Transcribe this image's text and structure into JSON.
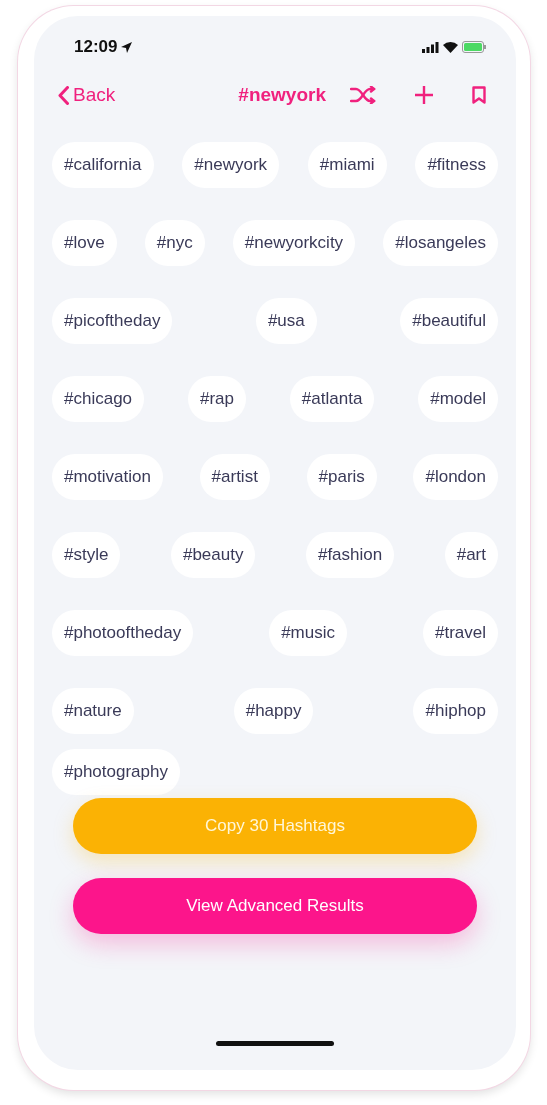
{
  "status_bar": {
    "time": "12:09"
  },
  "nav": {
    "back": "Back",
    "title": "#newyork"
  },
  "tag_rows": [
    [
      "#california",
      "#newyork",
      "#miami",
      "#fitness"
    ],
    [
      "#love",
      "#nyc",
      "#newyorkcity",
      "#losangeles"
    ],
    [
      "#picoftheday",
      "#usa",
      "#beautiful"
    ],
    [
      "#chicago",
      "#rap",
      "#atlanta",
      "#model"
    ],
    [
      "#motivation",
      "#artist",
      "#paris",
      "#london"
    ],
    [
      "#style",
      "#beauty",
      "#fashion",
      "#art"
    ],
    [
      "#photooftheday",
      "#music",
      "#travel"
    ],
    [
      "#nature",
      "#happy",
      "#hiphop"
    ],
    [
      "#photography"
    ]
  ],
  "buttons": [
    {
      "label": "Copy 30 Hashtags",
      "kind": "copy"
    },
    {
      "label": "View Advanced Results",
      "kind": "advanced"
    }
  ]
}
